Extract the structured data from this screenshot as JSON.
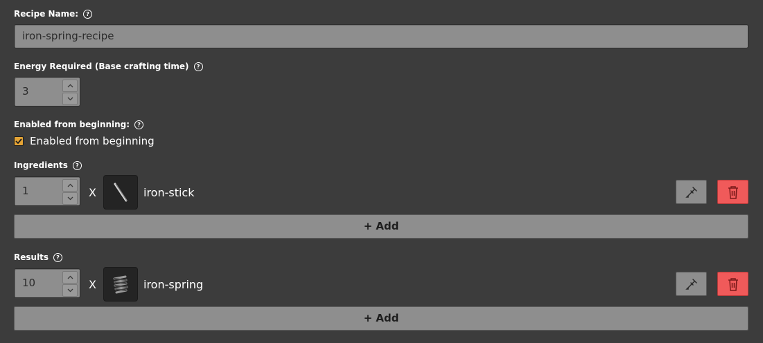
{
  "recipe_name": {
    "label": "Recipe Name:",
    "value": "iron-spring-recipe"
  },
  "energy": {
    "label": "Energy Required (Base crafting time)",
    "value": "3"
  },
  "enabled": {
    "label": "Enabled from beginning:",
    "checkbox_label": "Enabled from beginning",
    "checked": true
  },
  "ingredients": {
    "label": "Ingredients",
    "items": [
      {
        "amount": "1",
        "x": "X",
        "name": "iron-stick"
      }
    ],
    "add_label": "+ Add"
  },
  "results": {
    "label": "Results",
    "items": [
      {
        "amount": "10",
        "x": "X",
        "name": "iron-spring"
      }
    ],
    "add_label": "+ Add"
  },
  "help_glyph": "?",
  "colors": {
    "background": "#3c3c3c",
    "field": "#8e8e8e",
    "checkbox": "#e3a335",
    "delete": "#f05a5a"
  }
}
